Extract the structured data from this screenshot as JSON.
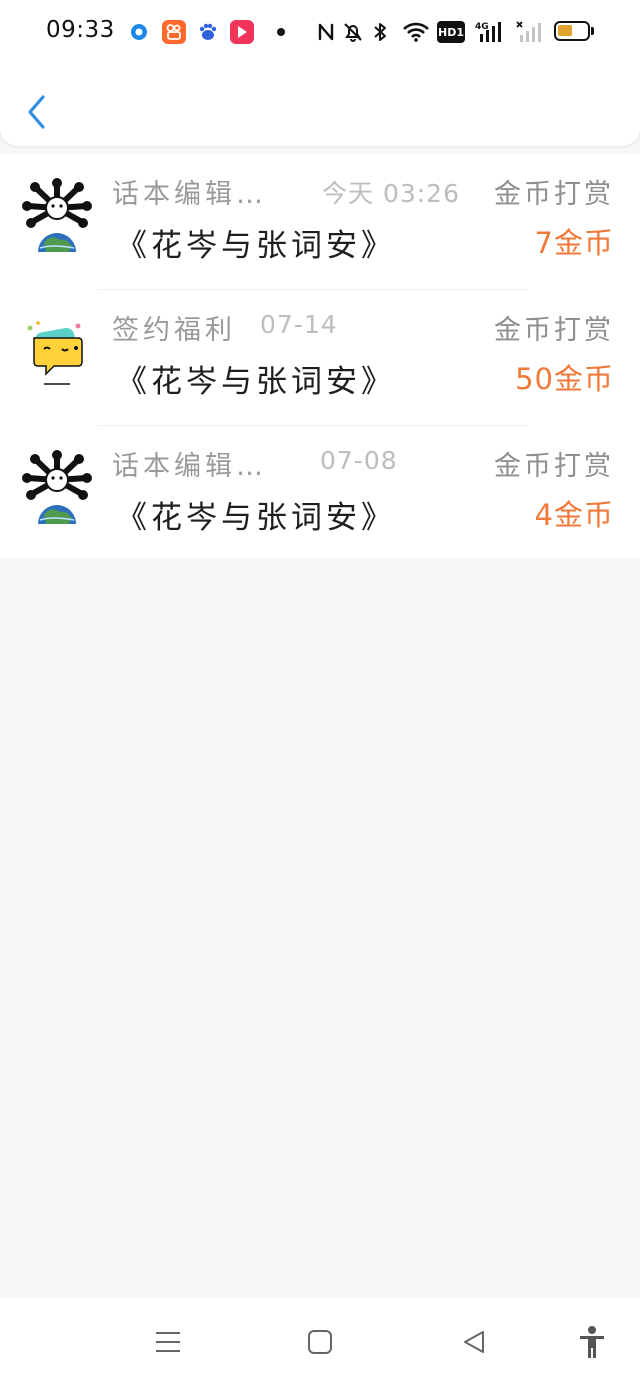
{
  "status_bar": {
    "time": "09:33",
    "hd_label": "HD1",
    "network_label": "4G",
    "battery_color": "#e0a42e"
  },
  "header": {
    "back_icon": "chevron-left-icon",
    "accent_color": "#2f8fe0"
  },
  "records": [
    {
      "avatar": "world-editor-avatar",
      "source": "话本编辑…",
      "time": "今天 03:26",
      "type": "金币打赏",
      "book": "《花岑与张词安》",
      "amount": "7金币"
    },
    {
      "avatar": "chat-bubble-avatar",
      "source": "签约福利",
      "time": "07-14",
      "type": "金币打赏",
      "book": "《花岑与张词安》",
      "amount": "50金币"
    },
    {
      "avatar": "world-editor-avatar",
      "source": "话本编辑…",
      "time": "07-08",
      "type": "金币打赏",
      "book": "《花岑与张词安》",
      "amount": "4金币"
    }
  ],
  "colors": {
    "amount": "#f07a3a",
    "background": "#f8f6f7"
  },
  "nav": {
    "items": [
      "menu-icon",
      "home-square-icon",
      "back-triangle-icon",
      "accessibility-icon"
    ]
  }
}
